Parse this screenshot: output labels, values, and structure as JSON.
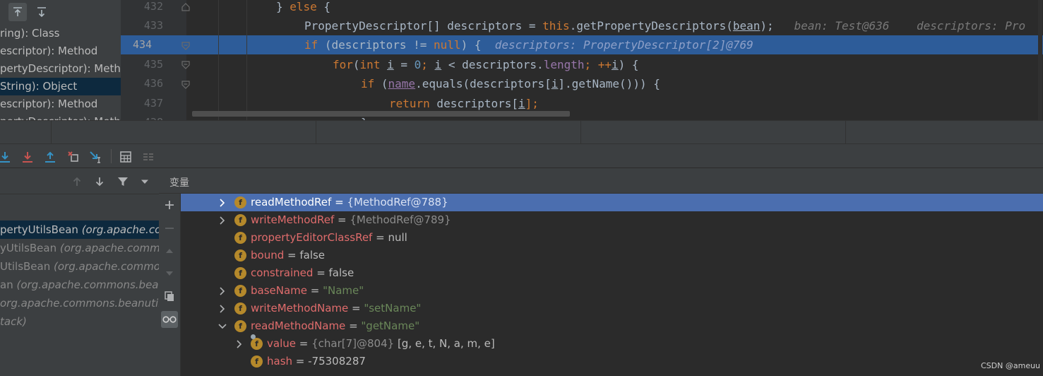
{
  "structure": {
    "items": [
      "ring): Class",
      "escriptor): Method",
      "pertyDescriptor): Method",
      "String): Object",
      "escriptor): Method",
      "pertyDescriptor): Meth"
    ]
  },
  "editor": {
    "lines": [
      {
        "num": "432"
      },
      {
        "num": "433"
      },
      {
        "num": "434"
      },
      {
        "num": "435"
      },
      {
        "num": "436"
      },
      {
        "num": "437"
      },
      {
        "num": "438"
      }
    ],
    "code": {
      "l432_a": "} ",
      "l432_b": "else",
      "l432_c": " {",
      "l433_a": "PropertyDescriptor[] descriptors = ",
      "l433_b": "this",
      "l433_c": ".getPropertyDescriptors(",
      "l433_d": "bean",
      "l433_e": ");",
      "l433_hint1": "bean: Test@636",
      "l433_hint2": "descriptors: Pro",
      "l434_a": "if",
      "l434_b": " (descriptors != ",
      "l434_c": "null",
      "l434_d": ") {",
      "l434_hint": "descriptors: PropertyDescriptor[2]@769",
      "l435_a": "for",
      "l435_b": "(",
      "l435_c": "int",
      "l435_d": " ",
      "l435_e": "i",
      "l435_f": " = ",
      "l435_g": "0",
      "l435_h": "; ",
      "l435_i": "i",
      "l435_j": " < descriptors.",
      "l435_k": "length",
      "l435_l": "; ++",
      "l435_m": "i",
      "l435_n": ") {",
      "l436_a": "if",
      "l436_b": " (",
      "l436_c": "name",
      "l436_d": ".equals(descriptors[",
      "l436_e": "i",
      "l436_f": "].getName())) {",
      "l437_a": "return",
      "l437_b": " descriptors[",
      "l437_c": "i",
      "l437_d": "];",
      "l438_a": "}"
    }
  },
  "debugger": {
    "toolbar_icons": [
      "step-into-icon",
      "force-step-into-icon",
      "step-out-icon",
      "drop-frame-icon",
      "run-to-cursor-icon",
      "evaluate-expression-icon",
      "trace-stream-icon"
    ],
    "frames": {
      "rows": [
        {
          "method": "pertyUtilsBean",
          "pkg": "(org.apache.comm"
        },
        {
          "method": "yUtilsBean",
          "pkg": "(org.apache.commo"
        },
        {
          "method": "UtilsBean",
          "pkg": "(org.apache.commo"
        },
        {
          "method": "an",
          "pkg": "(org.apache.commons.bean"
        },
        {
          "method": "",
          "pkg": "org.apache.commons.beanutils)"
        },
        {
          "method": "",
          "pkg": "tack)"
        }
      ]
    },
    "variables": {
      "title": "变量",
      "rows": [
        {
          "name": "readMethodRef",
          "eq": " = ",
          "ref": "{MethodRef@788}",
          "value": "",
          "expandable": "collapsed"
        },
        {
          "name": "writeMethodRef",
          "eq": " = ",
          "ref": "{MethodRef@789}",
          "value": "",
          "expandable": "collapsed"
        },
        {
          "name": "propertyEditorClassRef",
          "eq": " = ",
          "ref": "",
          "value": "null",
          "expandable": "none"
        },
        {
          "name": "bound",
          "eq": " = ",
          "ref": "",
          "value": "false",
          "expandable": "none"
        },
        {
          "name": "constrained",
          "eq": " = ",
          "ref": "",
          "value": "false",
          "expandable": "none"
        },
        {
          "name": "baseName",
          "eq": " = ",
          "ref": "",
          "value": "\"Name\"",
          "expandable": "collapsed"
        },
        {
          "name": "writeMethodName",
          "eq": " = ",
          "ref": "",
          "value": "\"setName\"",
          "expandable": "collapsed"
        },
        {
          "name": "readMethodName",
          "eq": " = ",
          "ref": "",
          "value": "\"getName\"",
          "expandable": "expanded"
        },
        {
          "name": "value",
          "eq": " = ",
          "ref": "{char[7]@804}",
          "value": " [g, e, t, N, a, m, e]",
          "expandable": "collapsed"
        },
        {
          "name": "hash",
          "eq": " = ",
          "ref": "",
          "value": "-75308287",
          "expandable": "none"
        }
      ]
    }
  },
  "watermark": "CSDN @ameuu"
}
